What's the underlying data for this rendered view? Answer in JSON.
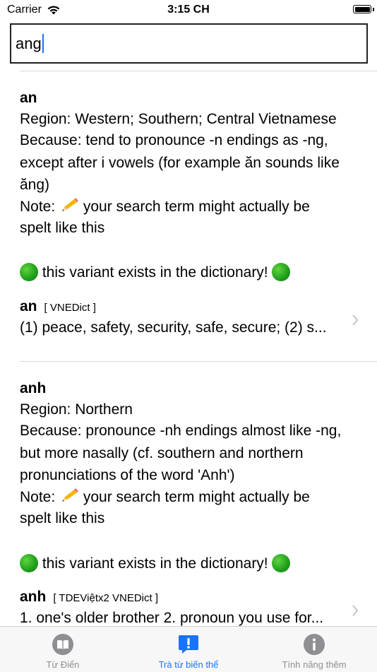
{
  "status": {
    "carrier": "Carrier",
    "time": "3:15 CH"
  },
  "search": {
    "value": "ang"
  },
  "entries": [
    {
      "word": "an",
      "region": "Region: Western; Southern; Central Vietnamese",
      "because_1": "Because: tend to pronounce -n endings as -ng,",
      "because_2": "except after i vowels (for example ăn sounds like",
      "because_3": "ăng)",
      "note_1a": "Note: ",
      "note_1b": " your search term might actually be",
      "note_2": "spelt like this",
      "exists": " this variant exists in the dictionary! ",
      "result_word": "an",
      "result_source": "[  VNEDict  ]",
      "result_definition": "(1) peace, safety, security, safe, secure; (2) s..."
    },
    {
      "word": "anh",
      "region": "Region: Northern",
      "because_1": "Because: pronounce -nh endings almost like -ng,",
      "because_2": "but more nasally (cf. southern and northern",
      "because_3": "pronunciations of the word 'Anh')",
      "note_1a": "Note: ",
      "note_1b": " your search term might actually be",
      "note_2": "spelt like this",
      "exists": " this variant exists in the dictionary! ",
      "result_word": "anh",
      "result_source": "[  TDEViệtx2 VNEDict  ]",
      "result_definition": "1. one's older brother 2. pronoun you use for..."
    }
  ],
  "tabs": [
    {
      "label": "Từ Điển",
      "icon": "book-icon",
      "active": false
    },
    {
      "label": "Trà từ biến thể",
      "icon": "exclamation-bubble-icon",
      "active": true
    },
    {
      "label": "Tính năng thêm",
      "icon": "info-icon",
      "active": false
    }
  ],
  "colors": {
    "accent": "#1a73ff",
    "inactive": "#8e8e93",
    "dot_green": "#1f9d1a"
  }
}
